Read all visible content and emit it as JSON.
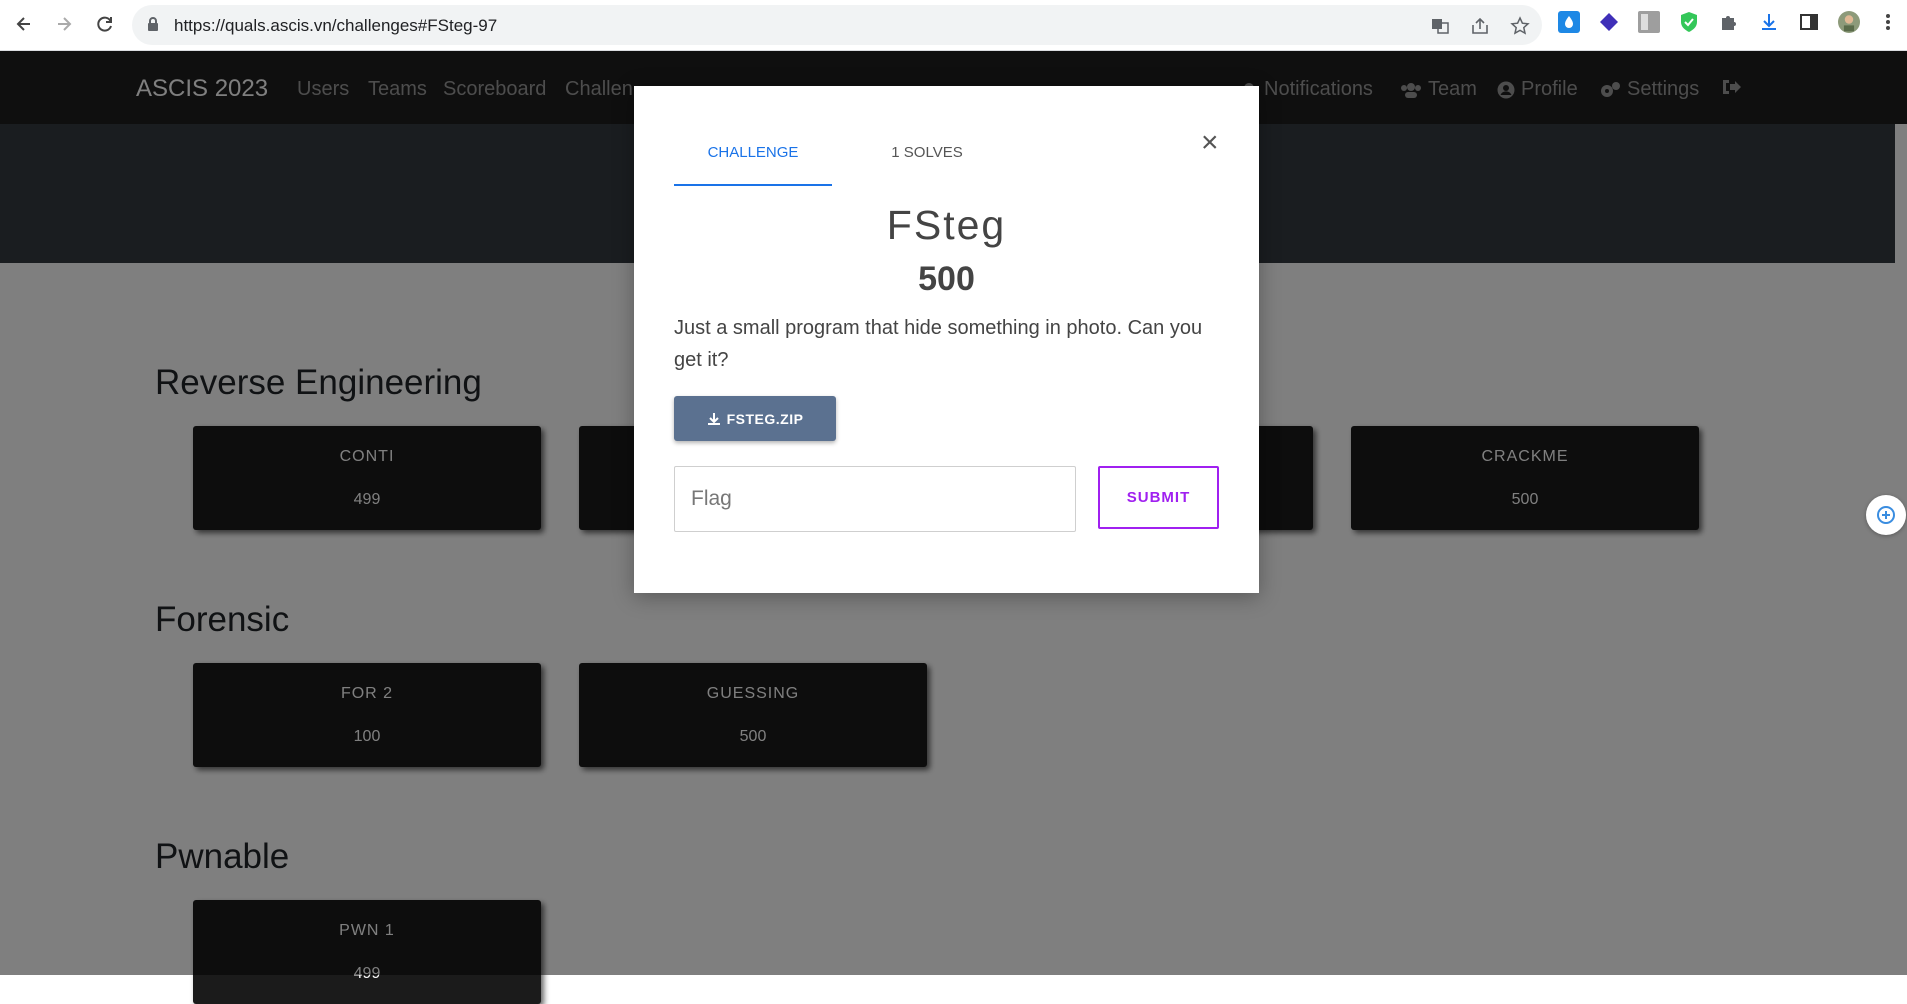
{
  "browser": {
    "url": "https://quals.ascis.vn/challenges#FSteg-97"
  },
  "site": {
    "brand": "ASCIS 2023",
    "nav": {
      "users": "Users",
      "teams": "Teams",
      "scoreboard": "Scoreboard",
      "challenges": "Challen",
      "notifications": "Notifications",
      "team": "Team",
      "profile": "Profile",
      "settings": "Settings"
    }
  },
  "categories": [
    {
      "name": "Reverse Engineering",
      "cards": [
        {
          "name": "CONTI",
          "value": "499"
        },
        {
          "name": "",
          "value": ""
        },
        {
          "name": "",
          "value": ""
        },
        {
          "name": "CRACKME",
          "value": "500"
        }
      ]
    },
    {
      "name": "Forensic",
      "cards": [
        {
          "name": "FOR 2",
          "value": "100"
        },
        {
          "name": "GUESSING",
          "value": "500"
        }
      ]
    },
    {
      "name": "Pwnable",
      "cards": [
        {
          "name": "PWN 1",
          "value": "499"
        }
      ]
    }
  ],
  "modal": {
    "tab_challenge": "CHALLENGE",
    "tab_solves": "1 SOLVES",
    "close": "×",
    "title": "FSteg",
    "value": "500",
    "description": "Just a small program that hide something in photo. Can you get it?",
    "file_label": "FSTEG.ZIP",
    "flag_placeholder": "Flag",
    "submit_label": "SUBMIT"
  },
  "colors": {
    "accent": "#1a73e8",
    "submit": "#a020f0",
    "file_button": "#5b7190",
    "navbar": "#1f1f1f",
    "card": "#1b1b1b"
  }
}
